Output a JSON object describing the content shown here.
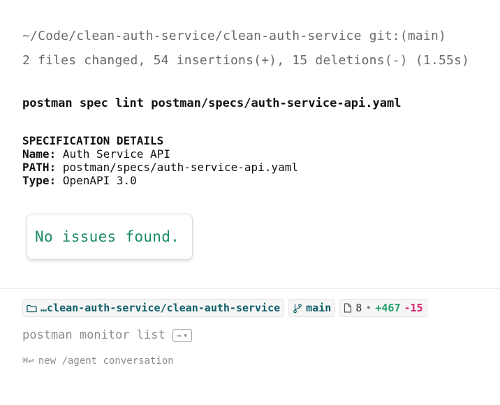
{
  "terminal": {
    "path": "~/Code/clean-auth-service/clean-auth-service",
    "git_label": "git:(main)",
    "stats": "2 files changed, 54 insertions(+), 15 deletions(-) (1.55s)",
    "command": "postman spec lint postman/specs/auth-service-api.yaml",
    "details": {
      "heading": "SPECIFICATION DETAILS",
      "name_key": "Name:",
      "name_value": "Auth Service API",
      "path_key": "PATH:",
      "path_value": "postman/specs/auth-service-api.yaml",
      "type_key": "Type:",
      "type_value": "OpenAPI 3.0"
    },
    "result": "No issues found."
  },
  "status_bar": {
    "folder": "…clean-auth-service/clean-auth-service",
    "branch": "main",
    "files_count": "8",
    "separator": "•",
    "insertions": "+467",
    "deletions": "-15"
  },
  "prompt": {
    "text": "postman monitor list",
    "send_arrow": "→",
    "send_caret": "▾"
  },
  "hint": {
    "shortcut": "⌘↩",
    "text": "new /agent conversation"
  },
  "colors": {
    "success": "#1a8a62",
    "folder_text": "#0f5f68",
    "insertions": "#1fa36b",
    "deletions": "#d8226a"
  },
  "icons": [
    "folder-icon",
    "git-branch-icon",
    "file-icon",
    "arrow-right-icon",
    "chevron-down-icon"
  ]
}
